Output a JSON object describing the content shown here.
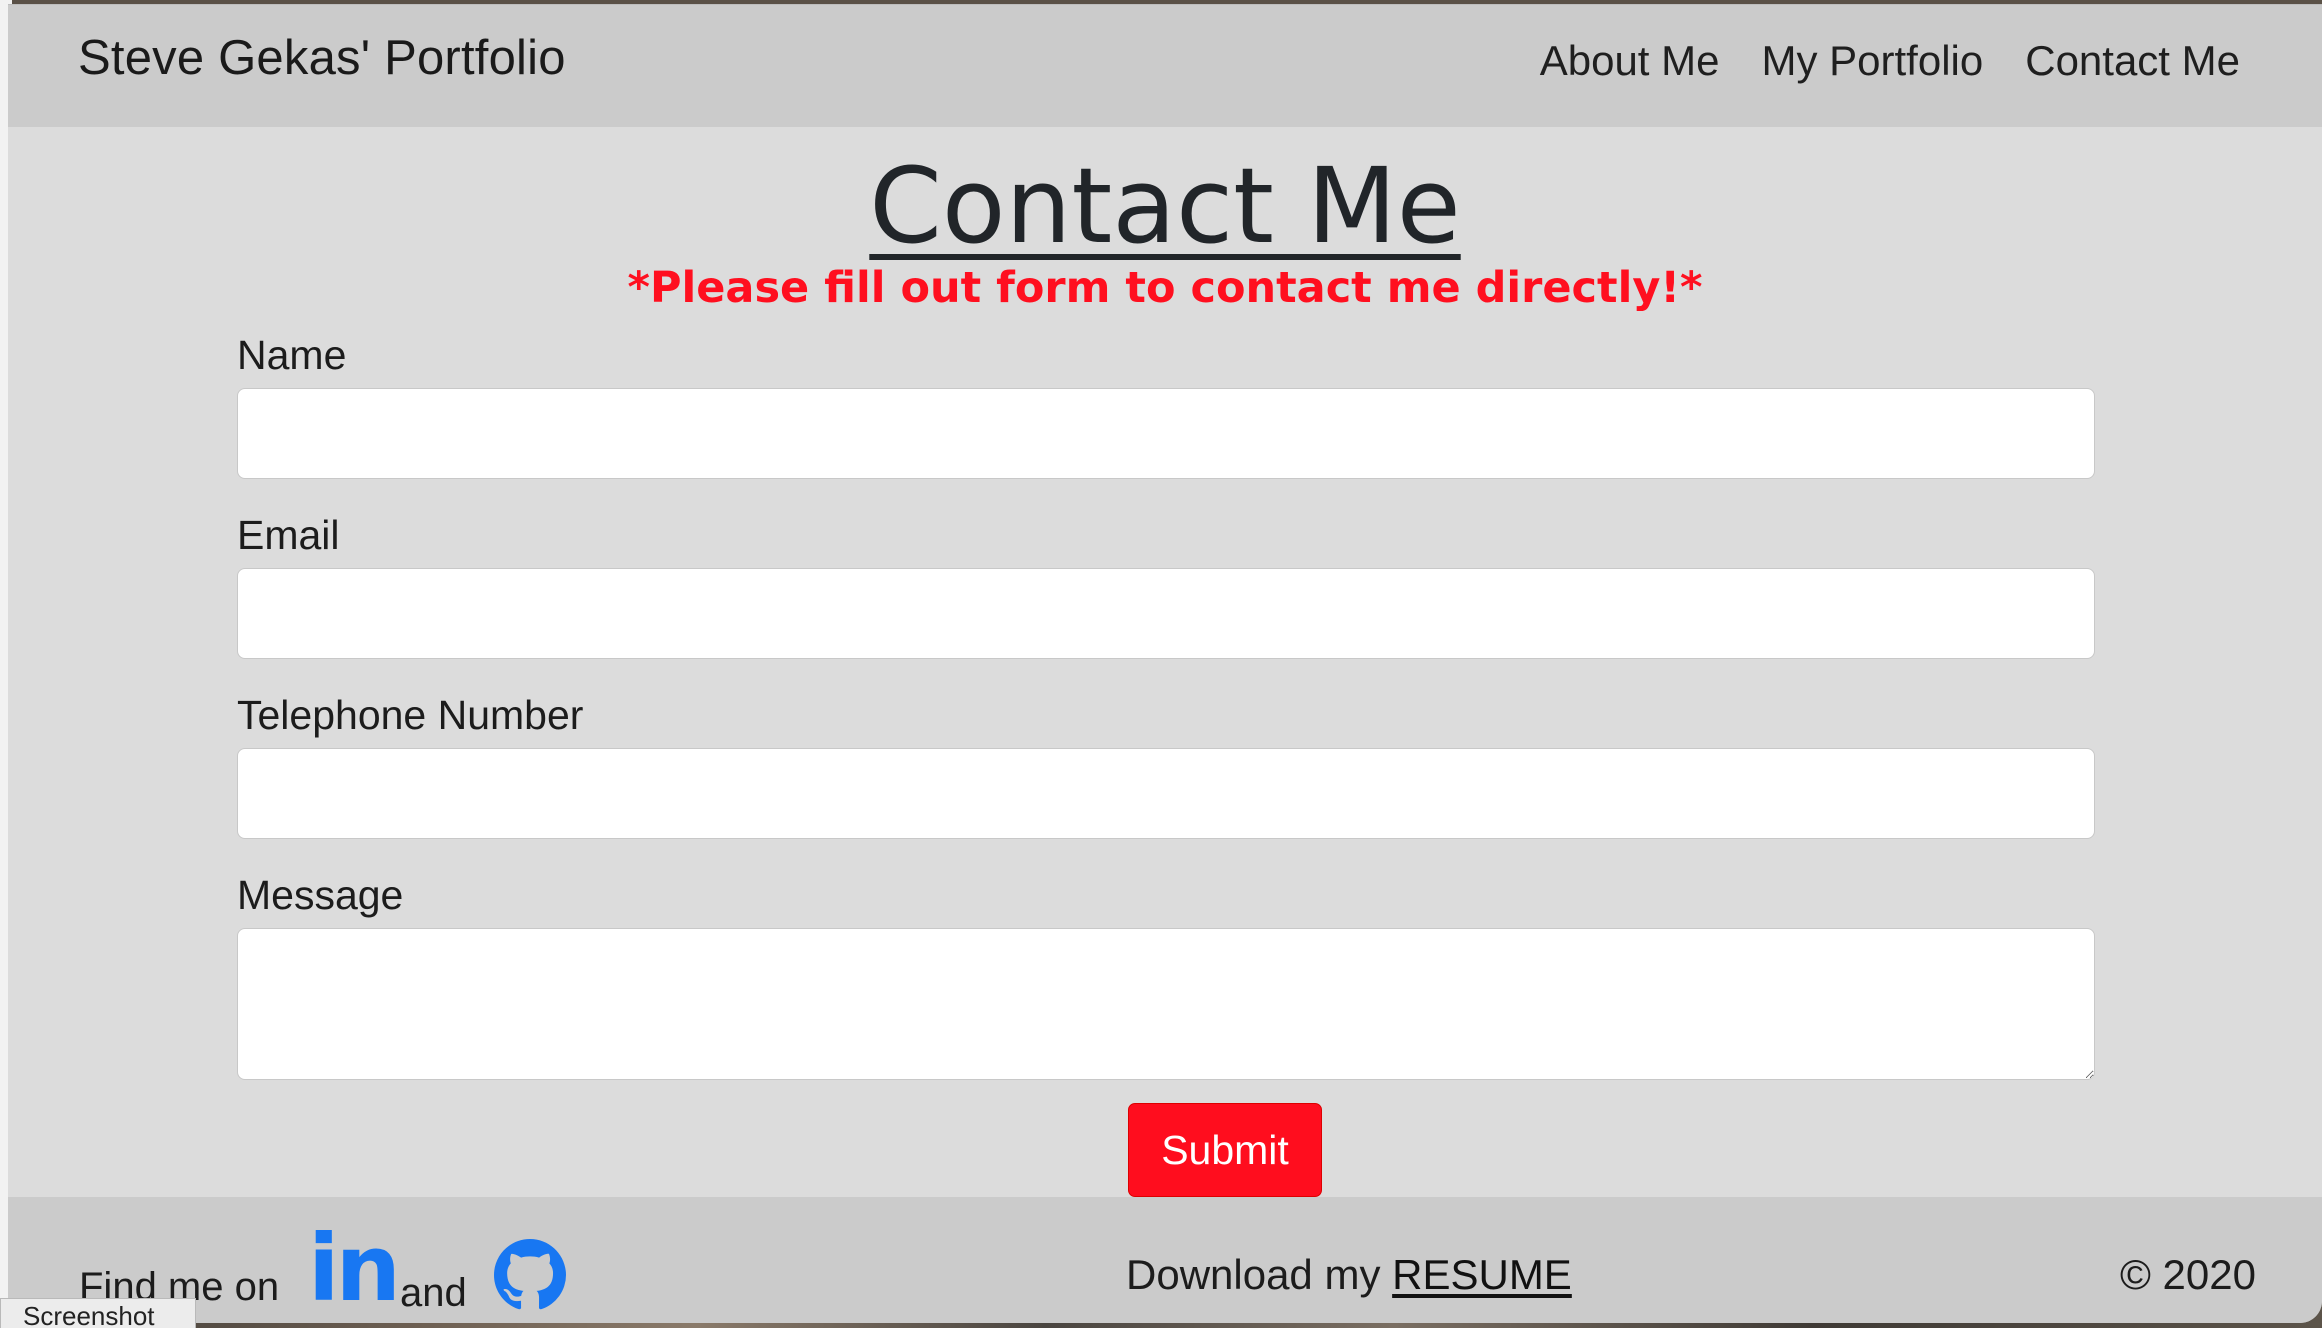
{
  "navbar": {
    "brand": "Steve Gekas' Portfolio",
    "links": [
      "About Me",
      "My Portfolio",
      "Contact Me"
    ]
  },
  "main": {
    "title": "Contact Me",
    "notice": "*Please fill out form to contact me directly!*",
    "fields": [
      {
        "label": "Name",
        "value": ""
      },
      {
        "label": "Email",
        "value": ""
      },
      {
        "label": "Telephone Number",
        "value": ""
      },
      {
        "label": "Message",
        "value": ""
      }
    ],
    "submit_label": "Submit"
  },
  "footer": {
    "find_me": "Find me on",
    "linkedin_glyph": "in",
    "and": "and",
    "download_prefix": "Download my",
    "resume_link": "RESUME",
    "copyright": "© 2020"
  },
  "overlay": {
    "screenshot_label": "Screenshot"
  },
  "colors": {
    "accent_red": "#ff0d1e",
    "linkedin_blue": "#1877f2",
    "navbar_bg": "#cbcbcb",
    "page_bg": "#dcdcdc"
  }
}
